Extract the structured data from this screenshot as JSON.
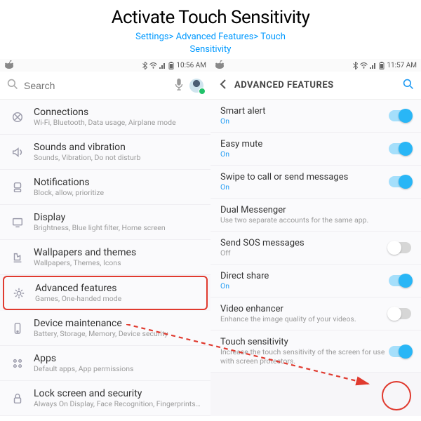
{
  "title": "Activate Touch Sensitivity",
  "breadcrumb_line1": "Settings> Advanced Features> Touch",
  "breadcrumb_line2": "Sensitivity",
  "left": {
    "time": "10:56 AM",
    "search_placeholder": "Search",
    "rows": [
      {
        "name": "Connections",
        "sub": "Wi-Fi, Bluetooth, Data usage, Airplane mode"
      },
      {
        "name": "Sounds and vibration",
        "sub": "Sounds, Vibration, Do not disturb"
      },
      {
        "name": "Notifications",
        "sub": "Block, allow, prioritize"
      },
      {
        "name": "Display",
        "sub": "Brightness, Blue light filter, Home screen"
      },
      {
        "name": "Wallpapers and themes",
        "sub": "Wallpapers, Themes, Icons"
      },
      {
        "name": "Advanced features",
        "sub": "Games, One-handed mode"
      },
      {
        "name": "Device maintenance",
        "sub": "Battery, Storage, Memory, Device security"
      },
      {
        "name": "Apps",
        "sub": "Default apps, App permissions"
      },
      {
        "name": "Lock screen and security",
        "sub": "Always On Display, Face Recognition, Fingerprints, Iris"
      }
    ]
  },
  "right": {
    "time": "11:57 AM",
    "header": "ADVANCED FEATURES",
    "rows": [
      {
        "name": "Smart alert",
        "sub": "On",
        "sub_on": true,
        "toggle": "on"
      },
      {
        "name": "Easy mute",
        "sub": "On",
        "sub_on": true,
        "toggle": "on"
      },
      {
        "name": "Swipe to call or send messages",
        "sub": "On",
        "sub_on": true,
        "toggle": "on"
      },
      {
        "name": "Dual Messenger",
        "sub": "Use two separate accounts for the same app.",
        "sub_on": false,
        "toggle": "none"
      },
      {
        "name": "Send SOS messages",
        "sub": "Off",
        "sub_on": false,
        "toggle": "off"
      },
      {
        "name": "Direct share",
        "sub": "On",
        "sub_on": true,
        "toggle": "on"
      },
      {
        "name": "Video enhancer",
        "sub": "Enhance the image quality of your videos.",
        "sub_on": false,
        "toggle": "off"
      },
      {
        "name": "Touch sensitivity",
        "sub": "Increase the touch sensitivity of the screen for use with screen protectors.",
        "sub_on": false,
        "toggle": "on"
      }
    ]
  }
}
